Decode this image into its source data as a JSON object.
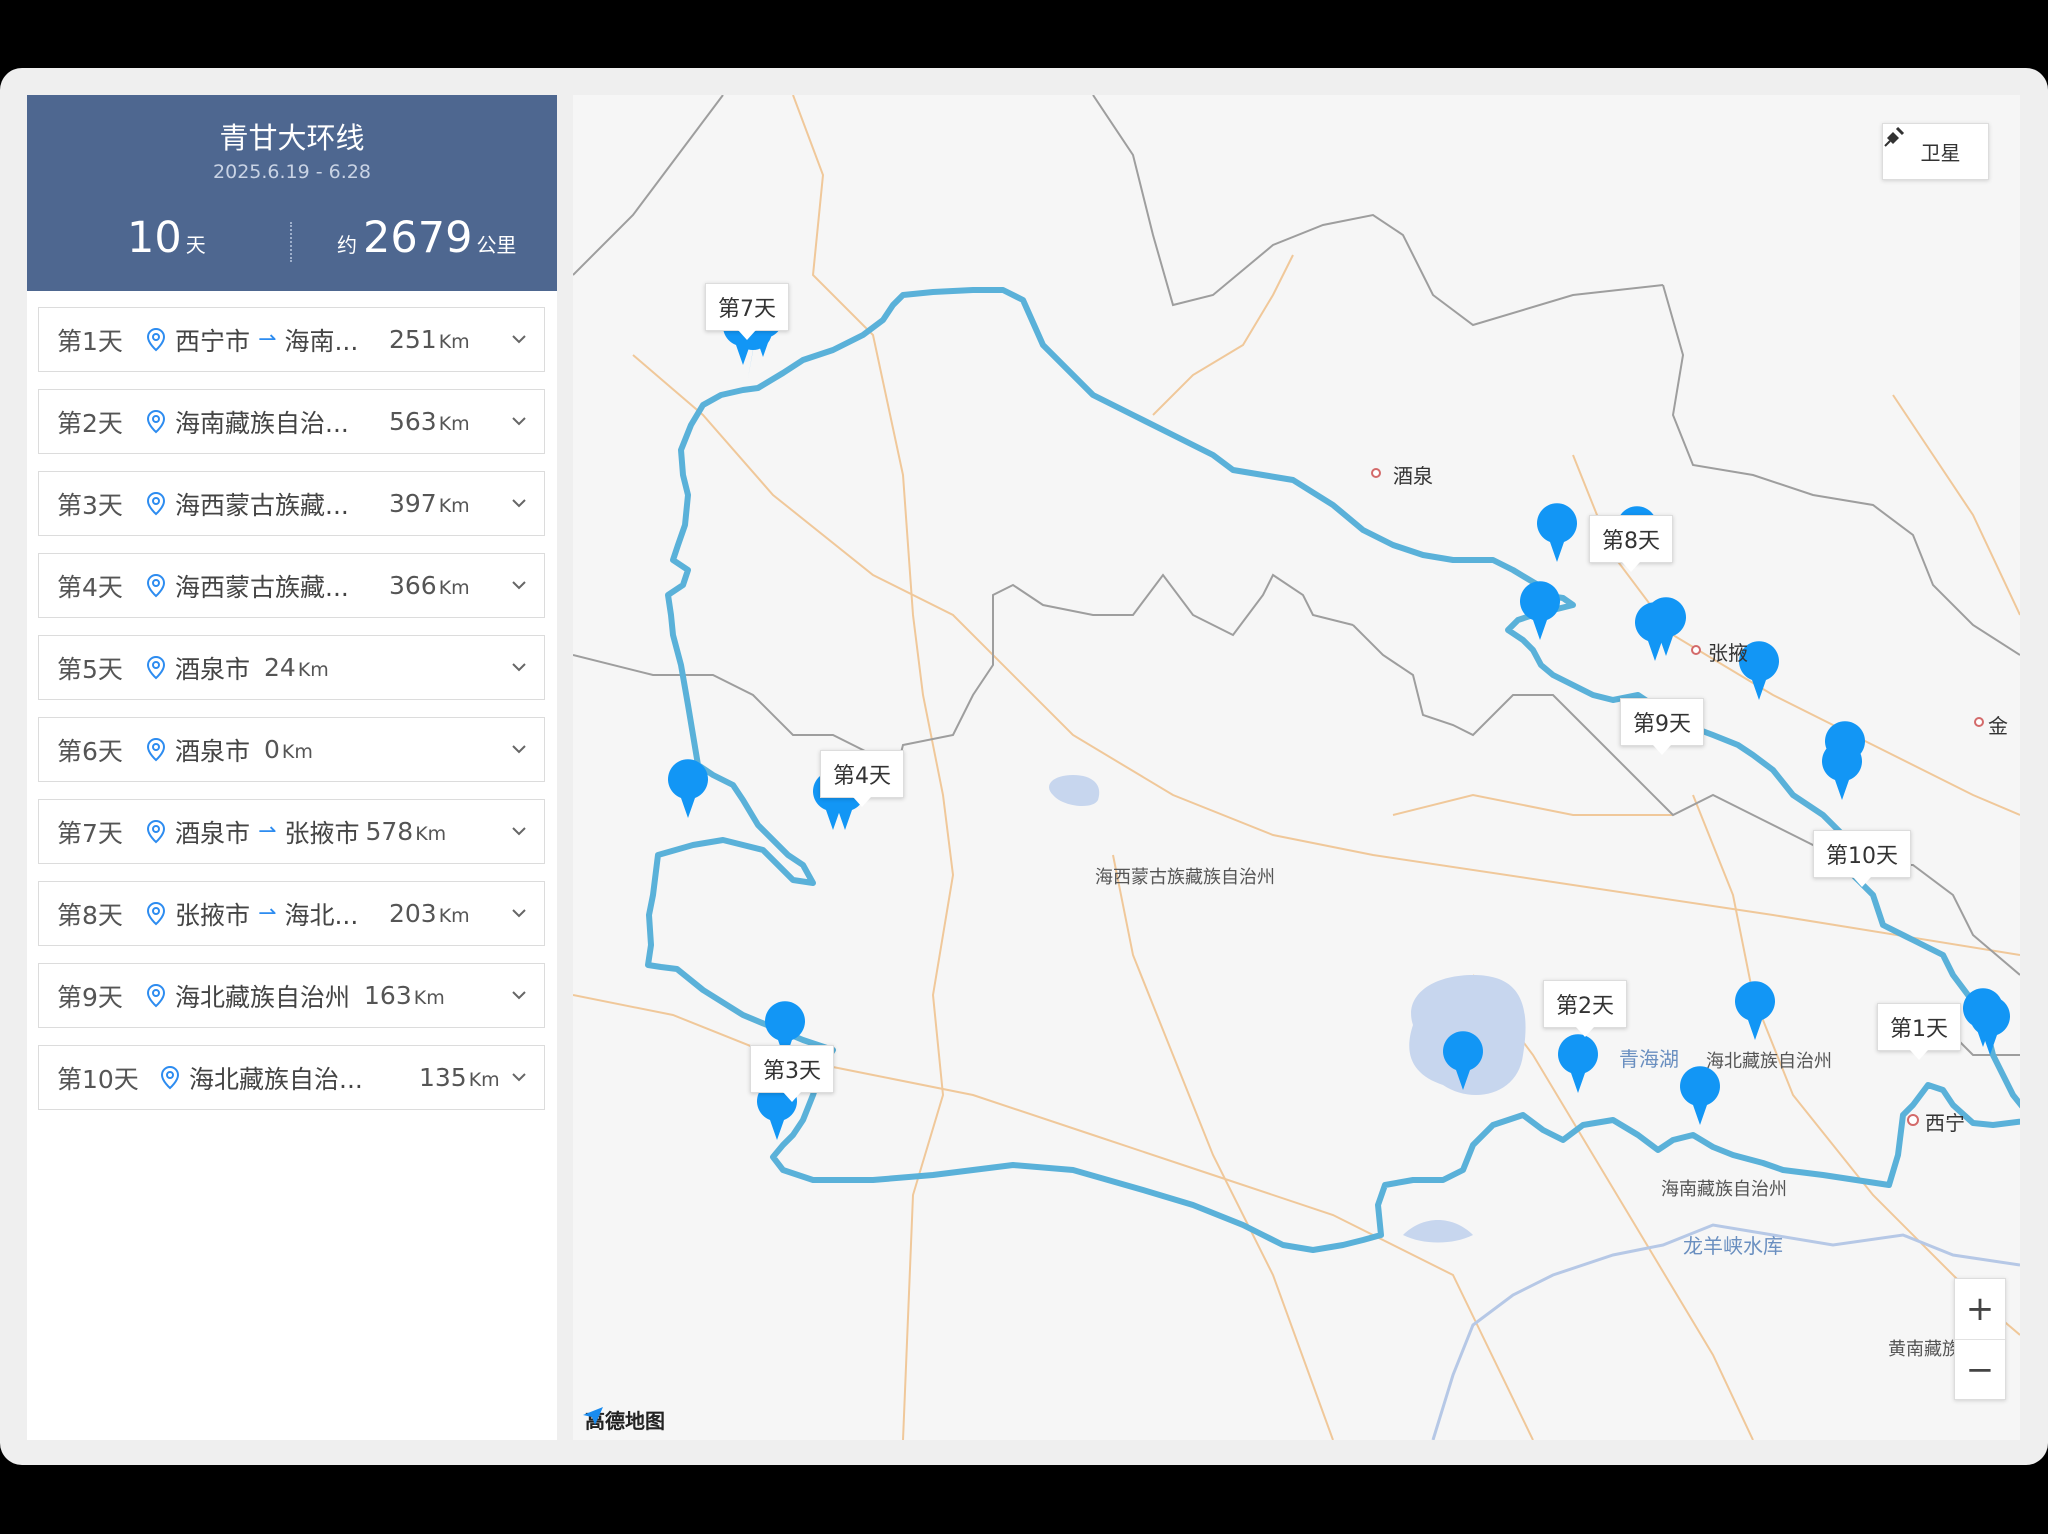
{
  "trip": {
    "title": "青甘大环线",
    "dates": "2025.6.19 - 6.28",
    "days_value": "10",
    "days_unit": "天",
    "distance_prefix": "约",
    "distance_value": "2679",
    "distance_unit": "公里"
  },
  "days": [
    {
      "label": "第1天",
      "from": "西宁市",
      "to": "海南...",
      "distance": "251",
      "unit": "Km"
    },
    {
      "label": "第2天",
      "from": "海南藏族自治...",
      "to": "",
      "distance": "563",
      "unit": "Km"
    },
    {
      "label": "第3天",
      "from": "海西蒙古族藏...",
      "to": "",
      "distance": "397",
      "unit": "Km"
    },
    {
      "label": "第4天",
      "from": "海西蒙古族藏...",
      "to": "",
      "distance": "366",
      "unit": "Km"
    },
    {
      "label": "第5天",
      "from": "酒泉市",
      "to": "",
      "distance": "24",
      "unit": "Km"
    },
    {
      "label": "第6天",
      "from": "酒泉市",
      "to": "",
      "distance": "0",
      "unit": "Km"
    },
    {
      "label": "第7天",
      "from": "酒泉市",
      "to": "张掖市",
      "distance": "578",
      "unit": "Km"
    },
    {
      "label": "第8天",
      "from": "张掖市",
      "to": "海北...",
      "distance": "203",
      "unit": "Km"
    },
    {
      "label": "第9天",
      "from": "海北藏族自治州",
      "to": "",
      "distance": "163",
      "unit": "Km"
    },
    {
      "label": "第10天",
      "from": "海北藏族自治...",
      "to": "",
      "distance": "135",
      "unit": "Km"
    }
  ],
  "map": {
    "satellite_label": "卫星",
    "zoom_in": "+",
    "zoom_out": "−",
    "provider": "高德地图",
    "callouts": {
      "day7": "第7天",
      "day8": "第8天",
      "day9": "第9天",
      "day4": "第4天",
      "day10": "第10天",
      "day2": "第2天",
      "day1": "第1天",
      "day3": "第3天"
    },
    "places": {
      "jiuquan": "酒泉",
      "zhangye": "张掖",
      "jin": "金",
      "haixi": "海西蒙古族藏族自治州",
      "qinghai_lake": "青海湖",
      "haibei": "海北藏族自治州",
      "xining": "西宁",
      "hainan": "海南藏族自治州",
      "longyangxia": "龙羊峡水库",
      "huangnan": "黄南藏族"
    },
    "colors": {
      "route": "#5ab1d9",
      "marker": "#1296f5",
      "border": "#9e9e9e",
      "road": "#f0c89a",
      "water": "#c7d6ee"
    },
    "icons": [
      "satellite-icon",
      "location-pin-icon",
      "route-arrow-icon",
      "chevron-down-icon",
      "map-marker-icon",
      "amap-logo-icon"
    ]
  }
}
